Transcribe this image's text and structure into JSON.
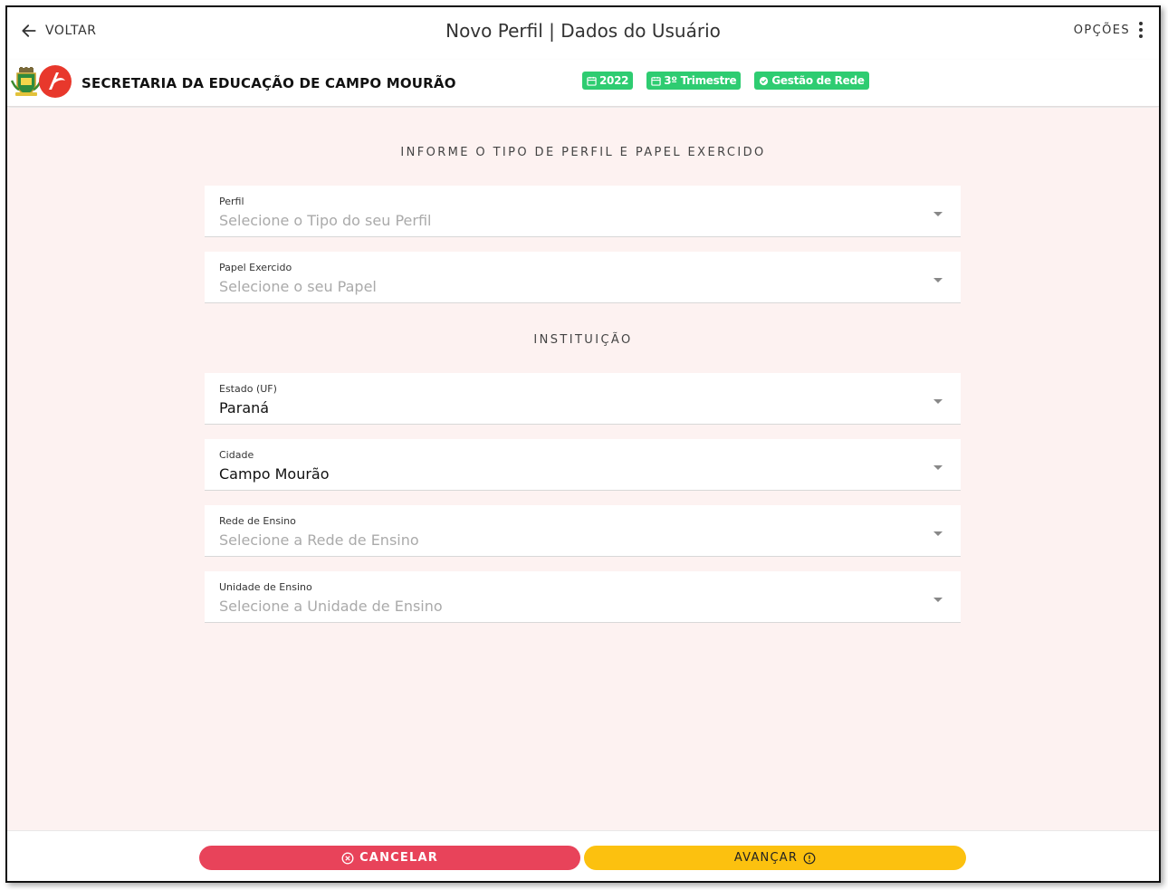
{
  "topbar": {
    "back_label": "VOLTAR",
    "title": "Novo Perfil | Dados do Usuário",
    "options_label": "OPÇÕES"
  },
  "header": {
    "org_name": "SECRETARIA DA EDUCAÇÃO DE CAMPO MOURÃO",
    "badges": [
      {
        "label": "2022",
        "icon": "calendar-icon"
      },
      {
        "label": "3º Trimestre",
        "icon": "calendar-icon"
      },
      {
        "label": "Gestão de Rede",
        "icon": "check-circle-icon"
      }
    ]
  },
  "sections": {
    "profile_title": "INFORME O TIPO DE PERFIL E PAPEL EXERCIDO",
    "institution_title": "INSTITUIÇÃO"
  },
  "fields": {
    "perfil": {
      "label": "Perfil",
      "placeholder": "Selecione o Tipo do seu Perfil",
      "value": ""
    },
    "papel": {
      "label": "Papel Exercido",
      "placeholder": "Selecione o seu Papel",
      "value": ""
    },
    "estado": {
      "label": "Estado (UF)",
      "placeholder": "",
      "value": "Paraná"
    },
    "cidade": {
      "label": "Cidade",
      "placeholder": "",
      "value": "Campo Mourão"
    },
    "rede": {
      "label": "Rede de Ensino",
      "placeholder": "Selecione a Rede de Ensino",
      "value": ""
    },
    "unidade": {
      "label": "Unidade de Ensino",
      "placeholder": "Selecione a Unidade de Ensino",
      "value": ""
    }
  },
  "footer": {
    "cancel_label": "CANCELAR",
    "next_label": "AVANÇAR"
  },
  "colors": {
    "badge_green": "#2ecc71",
    "cancel_red": "#e8435a",
    "next_yellow": "#fcc10f",
    "content_bg": "#fdf2f1"
  }
}
